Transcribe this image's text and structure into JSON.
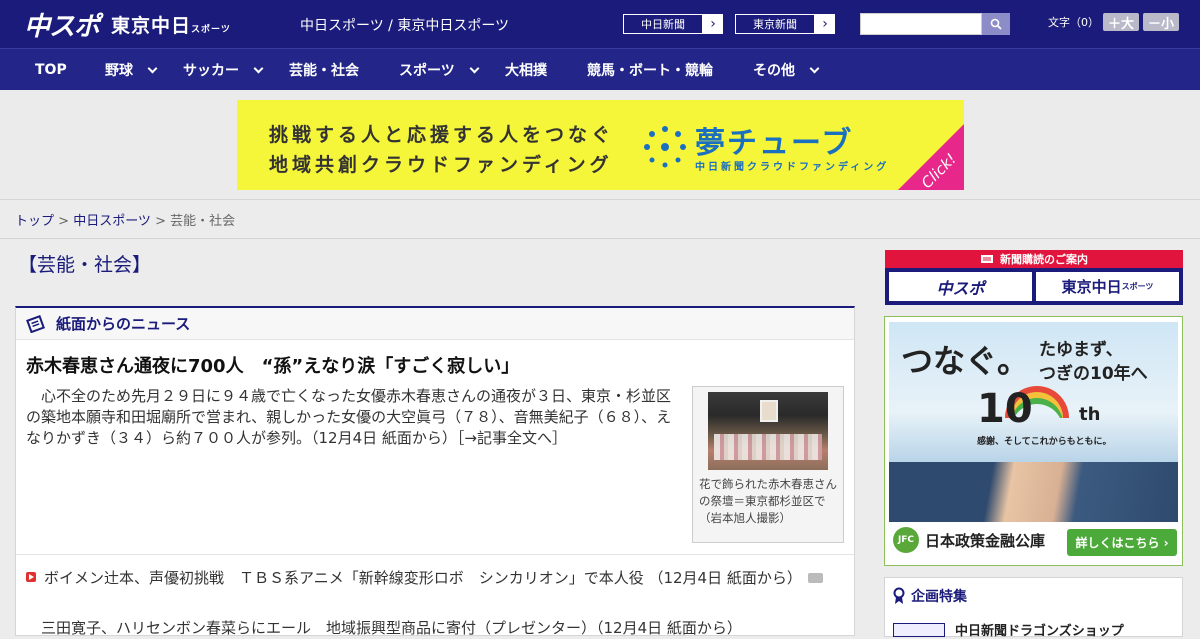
{
  "header": {
    "logo_main": "中スポ",
    "logo_sub": "東京中日",
    "logo_sub_small": "スポーツ",
    "site_title": "中日スポーツ / 東京中日スポーツ",
    "ext_links": [
      {
        "label": "中日新聞",
        "arrow": "›"
      },
      {
        "label": "東京新聞",
        "arrow": "›"
      }
    ],
    "search": {
      "value": "",
      "placeholder": ""
    },
    "fontsize": {
      "label": "文字（0）",
      "larger": "＋大",
      "smaller": "－小"
    }
  },
  "nav": {
    "items": [
      {
        "label": "TOP",
        "has_dropdown": false
      },
      {
        "label": "野球",
        "has_dropdown": true
      },
      {
        "label": "サッカー",
        "has_dropdown": true
      },
      {
        "label": "芸能・社会",
        "has_dropdown": false
      },
      {
        "label": "スポーツ",
        "has_dropdown": true
      },
      {
        "label": "大相撲",
        "has_dropdown": false
      },
      {
        "label": "競馬・ボート・競輪",
        "has_dropdown": false
      },
      {
        "label": "その他",
        "has_dropdown": true
      }
    ]
  },
  "banner": {
    "line1": "挑戦する人と応援する人をつなぐ",
    "line2": "地域共創クラウドファンディング",
    "brand": "夢チューブ",
    "brand_sub": "中日新聞クラウドファンディング",
    "click": "Click!"
  },
  "breadcrumb": {
    "top": "トップ",
    "sep": " > ",
    "parent": "中日スポーツ",
    "current": "芸能・社会"
  },
  "main": {
    "section_title": "【芸能・社会】",
    "box_title": "紙面からのニュース",
    "headline": "赤木春恵さん通夜に700人　“孫”えなり涙「すごく寂しい」",
    "lead": "　心不全のため先月２９日に９４歳で亡くなった女優赤木春恵さんの通夜が３日、東京・杉並区の築地本願寺和田堀廟所で営まれ、親しかった女優の大空眞弓（７８）、音無美紀子（６８）、えなりかずき（３４）ら約７００人が参列。（12月4日 紙面から）",
    "lead_more": "［→記事全文へ］",
    "photo_caption": "花で飾られた赤木春恵さんの祭壇＝東京都杉並区で（岩本旭人撮影）",
    "list": [
      "ボイメン辻本、声優初挑戦　ＴＢＳ系アニメ「新幹線変形ロボ　シンカリオン」で本人役 （12月4日 紙面から）"
    ],
    "list2": "　三田寛子、ハリセンボン春菜らにエール　地域振興型商品に寄付（プレゼンター）（12月4日 紙面から）"
  },
  "sidebar": {
    "subscribe_head": "新聞購読のご案内",
    "subscribe_btn1": "中スポ",
    "subscribe_btn2": "東京中日",
    "subscribe_btn2_small": "スポーツ",
    "ad": {
      "t1": "つなぐ。",
      "t2a": "たゆまず、",
      "t2b": "つぎの10年へ",
      "ten": "10",
      "th": "th",
      "motto": "感謝、そしてこれからもともに。",
      "jfc": "JFC",
      "company": "日本政策金融公庫",
      "cta": "詳しくはこちら ›"
    },
    "feature_head": "企画特集",
    "feature_item": "中日新聞ドラゴンズショップ"
  },
  "colors": {
    "header_bg": "#1a1b7a",
    "nav_bg": "#232588",
    "banner_bg": "#f5f53a",
    "accent_pink": "#e8278a",
    "subscribe_red": "#e0143c",
    "ad_green": "#4caa3a"
  },
  "icons": [
    "search-icon",
    "chevron-down-icon",
    "newspaper-icon",
    "video-icon",
    "camera-icon",
    "ribbon-icon"
  ]
}
